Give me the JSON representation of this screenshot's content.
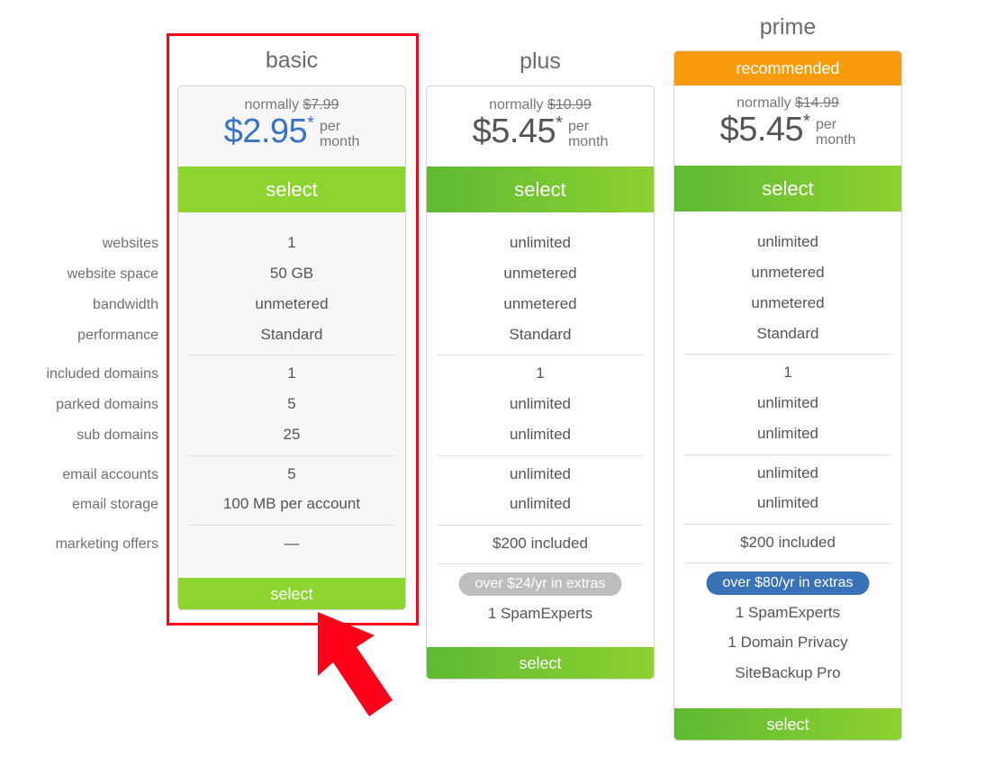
{
  "feature_labels": [
    "websites",
    "website space",
    "bandwidth",
    "performance",
    "included domains",
    "parked domains",
    "sub domains",
    "email accounts",
    "email storage",
    "marketing offers"
  ],
  "plans": [
    {
      "name": "basic",
      "normally_label": "normally",
      "original_price": "$7.99",
      "price": "$2.95",
      "asterisk": "*",
      "per": "per",
      "month": "month",
      "select_label": "select",
      "values": [
        "1",
        "50 GB",
        "unmetered",
        "Standard",
        "1",
        "5",
        "25",
        "5",
        "100 MB per account",
        "—"
      ],
      "price_color": "#3a72c7"
    },
    {
      "name": "plus",
      "normally_label": "normally",
      "original_price": "$10.99",
      "price": "$5.45",
      "asterisk": "*",
      "per": "per",
      "month": "month",
      "select_label": "select",
      "values": [
        "unlimited",
        "unmetered",
        "unmetered",
        "Standard",
        "1",
        "unlimited",
        "unlimited",
        "unlimited",
        "unlimited",
        "$200 included"
      ],
      "extras_badge": "over $24/yr in extras",
      "extras": [
        "1 SpamExperts"
      ]
    },
    {
      "name": "prime",
      "ribbon": "recommended",
      "normally_label": "normally",
      "original_price": "$14.99",
      "price": "$5.45",
      "asterisk": "*",
      "per": "per",
      "month": "month",
      "select_label": "select",
      "values": [
        "unlimited",
        "unmetered",
        "unmetered",
        "Standard",
        "1",
        "unlimited",
        "unlimited",
        "unlimited",
        "unlimited",
        "$200 included"
      ],
      "extras_badge": "over $80/yr in extras",
      "extras": [
        "1 SpamExperts",
        "1 Domain Privacy",
        "SiteBackup Pro"
      ]
    }
  ],
  "colors": {
    "green": "#8cd430",
    "orange_ribbon": "#f89c0e",
    "blue_badge": "#3a72b8",
    "gray_badge": "#bdbdbd",
    "annotation_red": "#ff0019"
  },
  "annotation": {
    "highlight_target": "basic plan",
    "arrow_icon": "arrow-up-left-icon"
  }
}
